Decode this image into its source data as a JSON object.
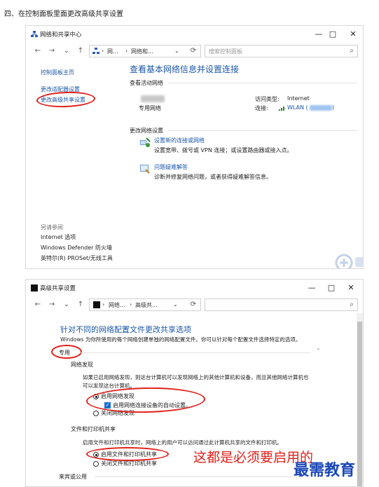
{
  "page": {
    "heading": "四、在控制面板里面更改高级共享设置"
  },
  "win1": {
    "title": "网络和共享中心",
    "controls": {
      "minimize": "—",
      "maximize": "□",
      "close": "✕"
    },
    "nav": {
      "back": "←",
      "forward": "→",
      "dropdown": "⌄",
      "up": "↑",
      "refresh": "⟳"
    },
    "address": {
      "crumb1": "网...",
      "sep": "›",
      "crumb2": "网络和...",
      "dropdown": "⌄"
    },
    "search": {
      "placeholder": "搜索控制面板"
    },
    "sidebar": {
      "home": "控制面板主页",
      "adapter": "更改适配器设置",
      "advanced": "更改高级共享设置",
      "see_also": "另请参阅",
      "links": [
        "Internet 选项",
        "Windows Defender 防火墙",
        "英特尔(R) PROSet/无线工具"
      ]
    },
    "main": {
      "title": "查看基本网络信息并设置连接",
      "active_networks": "查看活动网络",
      "network_type": "专用网络",
      "access_type_label": "访问类型:",
      "access_type_value": "Internet",
      "connection_label": "连接:",
      "connection_value": "WLAN (",
      "connection_close": ")",
      "change_settings": "更改网络设置",
      "new_conn_link": "设置新的连接或网络",
      "new_conn_desc": "设置宽带、拨号或 VPN 连接；或设置路由器或接入点。",
      "trouble_link": "问题疑难解答",
      "trouble_desc": "诊断并修复网络问题，或者获得疑难解答信息。"
    }
  },
  "win2": {
    "title": "高级共享设置",
    "controls": {
      "minimize": "—",
      "maximize": "□",
      "close": "✕"
    },
    "nav": {
      "back": "←",
      "forward": "→",
      "dropdown": "⌄",
      "up": "↑",
      "refresh": "⟳"
    },
    "address": {
      "crumb1": "网络...",
      "sep": "›",
      "crumb2": "高级共...",
      "dropdown": "⌄"
    },
    "main": {
      "title": "针对不同的网络配置文件更改共享选项",
      "desc": "Windows 为你所使用的每个网络创建单独的网络配置文件。你可以针对每个配置文件选择特定的选项。",
      "profile_private": "专用",
      "discovery_heading": "网络发现",
      "discovery_desc_1": "如果已启用网络发现，则这台计算机可以发现网络上的其他计算机和设备，而且其他网络计算机也",
      "discovery_desc_2": "可以发现这台计算机。",
      "discovery_on": "启用网络发现",
      "discovery_auto": "启用网络连接设备的自动设置。",
      "discovery_off": "关闭网络发现",
      "sharing_heading": "文件和打印机共享",
      "sharing_desc": "启用文件和打印机共享时，网络上的用户可以访问通过此计算机共享的文件和打印机。",
      "sharing_on": "启用文件和打印机共享",
      "sharing_off": "关闭文件和打印机共享",
      "profile_guest": "来宾或公用",
      "chevron": "⌃",
      "chevron_down": "⌄"
    }
  },
  "overlay": {
    "note": "这都是必须要启用的",
    "brand": "最需教育"
  },
  "colors": {
    "link": "#1a57a8",
    "annotation": "#e0201a",
    "brand": "#1946b8"
  }
}
